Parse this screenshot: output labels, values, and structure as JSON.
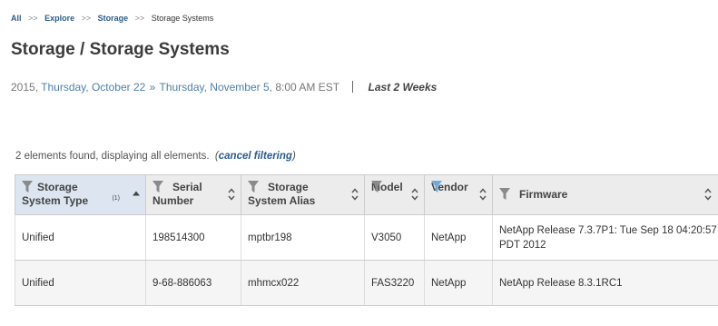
{
  "breadcrumb": {
    "items": [
      "All",
      "Explore",
      "Storage"
    ],
    "separator": ">>",
    "current": "Storage Systems"
  },
  "page": {
    "title": "Storage / Storage Systems"
  },
  "date_range": {
    "year": "2015,",
    "start": "Thursday, October 22",
    "arrow": "»",
    "end": "Thursday, November 5",
    "time": ", 8:00 AM EST",
    "preset": "Last 2 Weeks"
  },
  "results": {
    "summary": "2 elements found, displaying all elements.",
    "cancel_open": "(",
    "cancel_label": "cancel filtering",
    "cancel_close": ")"
  },
  "table": {
    "columns": [
      {
        "line1": "Storage",
        "line2": "System Type",
        "sort": "asc",
        "sort_index": "(1)",
        "filter_active": false
      },
      {
        "line1": "Serial",
        "line2": "Number",
        "sort": "none",
        "filter_active": false
      },
      {
        "line1": "Storage",
        "line2": "System Alias",
        "sort": "none",
        "filter_active": false
      },
      {
        "line1": "",
        "line2": "Model",
        "sort": "none",
        "filter_active": false
      },
      {
        "line1": "",
        "line2": "Vendor",
        "sort": "none",
        "filter_active": true
      },
      {
        "line1": "Firmware",
        "line2": "",
        "sort": "none",
        "filter_active": false
      }
    ],
    "rows": [
      {
        "type": "Unified",
        "serial": "198514300",
        "alias": "mptbr198",
        "model": "V3050",
        "vendor": "NetApp",
        "firmware": "NetApp Release 7.3.7P1: Tue Sep 18 04:20:57 PDT 2012"
      },
      {
        "type": "Unified",
        "serial": "9-68-886063",
        "alias": "mhmcx022",
        "model": "FAS3220",
        "vendor": "NetApp",
        "firmware": "NetApp Release 8.3.1RC1"
      }
    ]
  },
  "colors": {
    "link": "#2a5d8f",
    "filter_icon": "#8a8a8a",
    "filter_icon_active": "#6fa8dc",
    "header_bg": "#ececec",
    "sorted_header_bg": "#dde6f0"
  },
  "icons": {
    "filter": "funnel-icon",
    "sort": "sort-updown-icon",
    "sort_asc": "sort-ascending-icon"
  }
}
